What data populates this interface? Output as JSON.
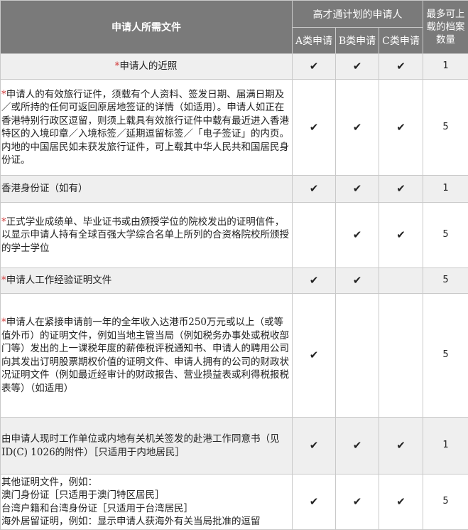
{
  "header": {
    "documents": "申请人所需文件",
    "scheme": "高才通计划的申请人",
    "cat_a": "A类申请",
    "cat_b": "B类申请",
    "cat_c": "C类申请",
    "max_files": "最多可上载的档案数量"
  },
  "check_symbol": "✔",
  "rows": [
    {
      "star": "*",
      "text": "申请人的近照",
      "a": "✔",
      "b": "✔",
      "c": "✔",
      "count": "1"
    },
    {
      "star": "*",
      "text": "申请人的有效旅行证件，须载有个人资料、签发日期、届满日期及／或所持的任何可返回原居地签证的详情（如适用）。申请人如正在香港特别行政区逗留，则须上载具有效旅行证件中载有最近进入香港特区的入境印章／入境标签／延期逗留标签／「电子签证」的内页。内地的中国居民如未获发旅行证件，可上载其中华人民共和国居民身份证。",
      "a": "✔",
      "b": "✔",
      "c": "✔",
      "count": "5"
    },
    {
      "star": "",
      "text": "香港身份证（如有）",
      "a": "✔",
      "b": "✔",
      "c": "✔",
      "count": "1"
    },
    {
      "star": "*",
      "text": "正式学业成绩单、毕业证书或由颁授学位的院校发出的证明信件，以显示申请人持有全球百强大学综合名单上所列的合资格院校所颁授的学士学位",
      "a": "",
      "b": "✔",
      "c": "✔",
      "count": "5"
    },
    {
      "star": "*",
      "text": "申请人工作经验证明文件",
      "a": "✔",
      "b": "✔",
      "c": "",
      "count": "5"
    },
    {
      "star": "*",
      "text": "申请人在紧接申请前一年的全年收入达港币250万元或以上（或等值外币）的证明文件，例如当地主管当局（例如税务办事处或税收部门等）发出的上一课税年度的薪俸税评税通知书、申请人的聘用公司向其发出订明股票期权价值的证明文件、申请人拥有的公司的财政状况证明文件（例如最近经审计的财政报告、营业损益表或利得税报税表等）（如适用）",
      "a": "✔",
      "b": "",
      "c": "",
      "count": "5"
    },
    {
      "star": "",
      "text": "由申请人现时工作单位或内地有关机关签发的赴港工作同意书（见ID(C) 1026的附件）［只适用于内地居民］",
      "a": "✔",
      "b": "✔",
      "c": "✔",
      "count": "1"
    },
    {
      "star": "",
      "text": "其他证明文件，例如：\n澳门身份证［只适用于澳门特区居民］\n台湾户籍和台湾身份证［只适用于台湾居民］\n海外居留证明，例如：显示申请人获海外有关当局批准的逗留",
      "a": "✔",
      "b": "✔",
      "c": "✔",
      "count": "5"
    }
  ]
}
